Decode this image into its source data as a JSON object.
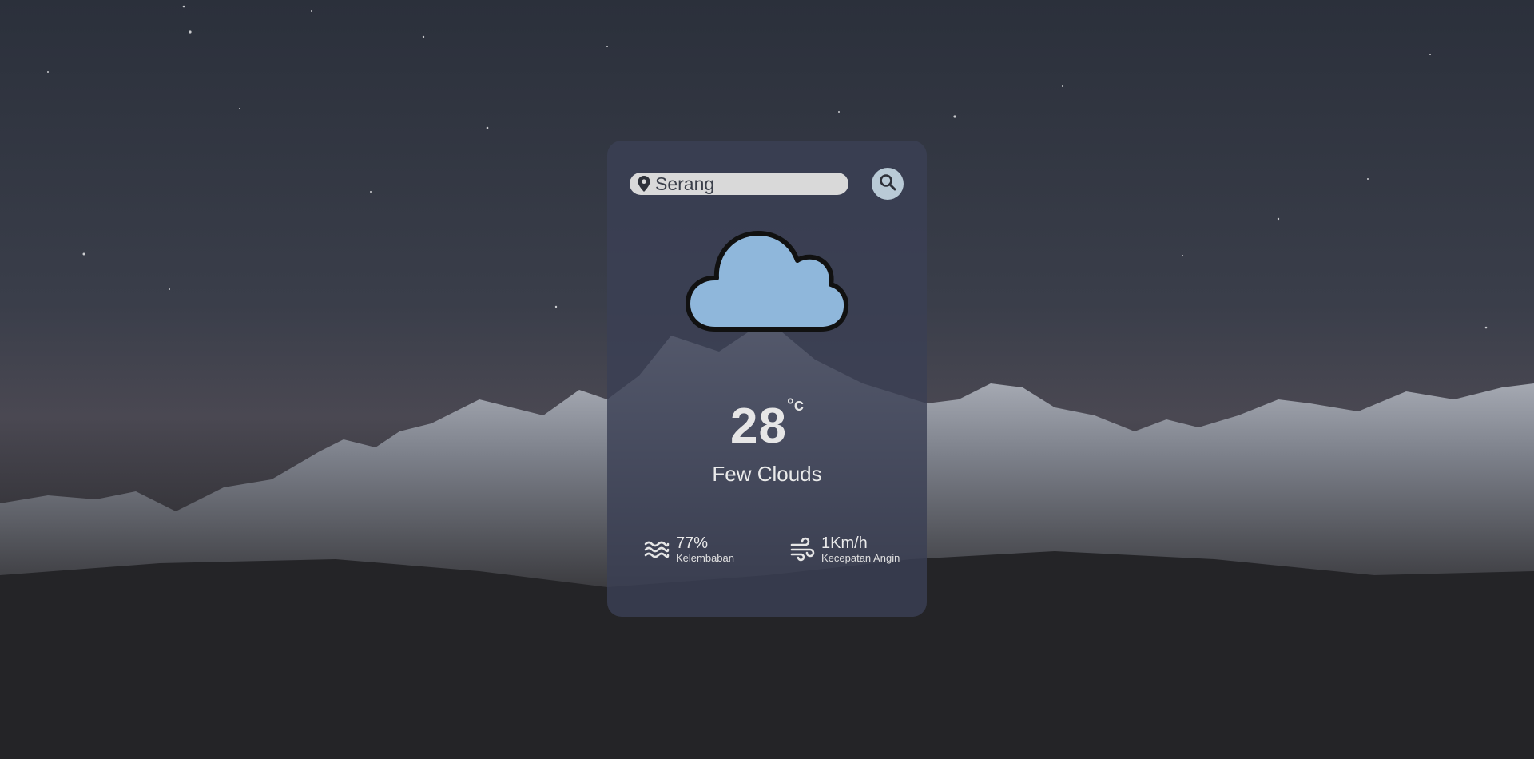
{
  "search": {
    "value": "Serang",
    "placeholder": "Serang"
  },
  "weather": {
    "icon": "cloud-icon",
    "temperature": "28",
    "unit": "°c",
    "description": "Few Clouds"
  },
  "humidity": {
    "value": "77%",
    "label": "Kelembaban",
    "icon": "water-waves-icon"
  },
  "wind": {
    "value": "1Km/h",
    "label": "Kecepatan Angin",
    "icon": "wind-icon"
  },
  "colors": {
    "card": "#3a4054",
    "search_field": "#d9d9d9",
    "search_button": "#b9cad6",
    "cloud_fill": "#8fb7db",
    "cloud_outline": "#111111"
  }
}
